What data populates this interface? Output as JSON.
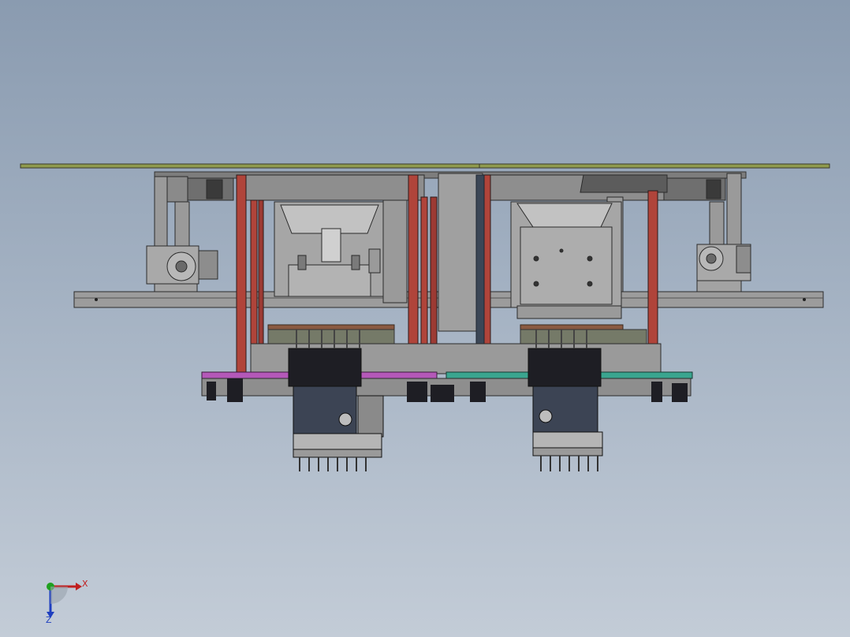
{
  "viewport": {
    "background_top": "#8a9bb0",
    "background_bottom": "#c3ccd7"
  },
  "model": {
    "frame_color": "#8c8c8c",
    "column_color": "#b0443a",
    "plate_left_color": "#b458b8",
    "plate_right_color": "#3aa58f",
    "top_plate_color": "#8f9a4e",
    "head_color": "#1e1e24"
  },
  "triad": {
    "x_label": "X",
    "z_label": "Z",
    "x_color": "#c01f1f",
    "y_color": "#1fa01f",
    "z_color": "#1f3fc0"
  }
}
